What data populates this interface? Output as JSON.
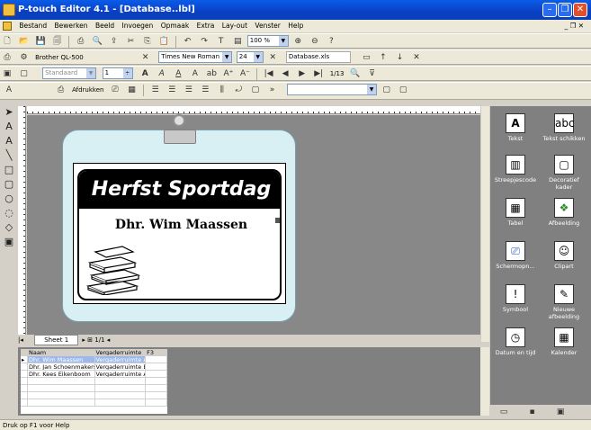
{
  "window": {
    "title": "P-touch Editor 4.1 - [Database..lbl]"
  },
  "menu": [
    "Bestand",
    "Bewerken",
    "Beeld",
    "Invoegen",
    "Opmaak",
    "Extra",
    "Lay-out",
    "Venster",
    "Help"
  ],
  "toolbar1": {
    "zoom": "100 %"
  },
  "toolbar2": {
    "printer": "Brother QL-500",
    "font": "Times New Roman",
    "font_size": "24",
    "database": "Database.xls"
  },
  "toolbar3": {
    "paper": "Standaard",
    "copies": "1",
    "print_label": "Afdrukken",
    "record": "1/13"
  },
  "label": {
    "title": "Herfst Sportdag",
    "name": "Dhr. Wim Maassen"
  },
  "sheet": {
    "tab": "Sheet 1",
    "pages": "1/1"
  },
  "database": {
    "columns": [
      "Naam",
      "Vergaderruimte",
      "F3"
    ],
    "rows": [
      [
        "Dhr. Wim Maassen",
        "Vergaderruimte A",
        ""
      ],
      [
        "Dhr. Jan Schoenmakers",
        "Vergaderruimte B",
        ""
      ],
      [
        "Dhr. Kees Eikenboom",
        "Vergaderruimte A",
        ""
      ]
    ]
  },
  "palette": [
    {
      "label": "Tekst",
      "icon": "text-icon"
    },
    {
      "label": "Tekst schikken",
      "icon": "arrange-text-icon"
    },
    {
      "label": "Streepjescode",
      "icon": "barcode-icon"
    },
    {
      "label": "Decoratief kader",
      "icon": "frame-icon"
    },
    {
      "label": "Tabel",
      "icon": "table-icon"
    },
    {
      "label": "Afbeelding",
      "icon": "image-icon"
    },
    {
      "label": "Schermopn...",
      "icon": "screenshot-icon"
    },
    {
      "label": "Clipart",
      "icon": "clipart-icon"
    },
    {
      "label": "Symbool",
      "icon": "symbol-icon"
    },
    {
      "label": "Nieuwe afbeelding",
      "icon": "new-image-icon"
    },
    {
      "label": "Datum en tijd",
      "icon": "clock-icon"
    },
    {
      "label": "Kalender",
      "icon": "calendar-icon"
    }
  ],
  "status": {
    "text": "Druk op F1 voor Help"
  }
}
